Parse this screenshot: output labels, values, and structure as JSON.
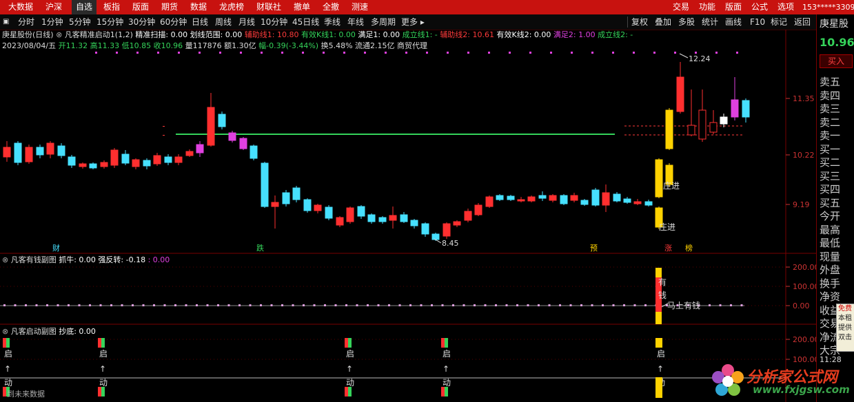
{
  "top_nav": {
    "items": [
      "大数据",
      "沪深",
      "自选",
      "板指",
      "版面",
      "期货",
      "数据",
      "龙虎榜",
      "财联社",
      "撤单",
      "全撤",
      "测速"
    ],
    "active_index": 2,
    "right_items": [
      "交易",
      "功能",
      "版面",
      "公式",
      "选项"
    ],
    "account": "153*****3309",
    "window_controls": [
      "—",
      "□",
      "×"
    ]
  },
  "toolbar": {
    "periods": [
      "分时",
      "1分钟",
      "5分钟",
      "15分钟",
      "30分钟",
      "60分钟",
      "日线",
      "周线",
      "月线",
      "10分钟",
      "45日线",
      "季线",
      "年线",
      "多周期",
      "更多 ▸"
    ],
    "right_items": [
      "复权",
      "叠加",
      "多股",
      "统计",
      "画线",
      "F10",
      "标记",
      "返回"
    ]
  },
  "main_info": {
    "stock": "庚星股份(日线)",
    "indicator": "凡客精准启动1(1,2)",
    "fields": [
      {
        "label": "精准扫描: 0.00",
        "color": "#ffffff"
      },
      {
        "label": "划线范围: 0.00",
        "color": "#ffffff"
      },
      {
        "label": "辅助线1: 10.80",
        "color": "#ff3a3a"
      },
      {
        "label": "有效K线1: 0.00",
        "color": "#35d35a"
      },
      {
        "label": "满足1: 0.00",
        "color": "#ffffff"
      },
      {
        "label": "成立线1: -",
        "color": "#35d35a"
      },
      {
        "label": "辅助线2: 10.61",
        "color": "#ff3a3a"
      },
      {
        "label": "有效K线2: 0.00",
        "color": "#ffffff"
      },
      {
        "label": "满足2: 1.00",
        "color": "#e040e0"
      },
      {
        "label": "成立线2: -",
        "color": "#35d35a"
      }
    ],
    "date": "2023/08/04/五",
    "quote": [
      {
        "label": "开11.32",
        "color": "#35d35a"
      },
      {
        "label": "高11.33",
        "color": "#35d35a"
      },
      {
        "label": "低10.85",
        "color": "#35d35a"
      },
      {
        "label": "收10.96",
        "color": "#35d35a"
      },
      {
        "label": "量117876",
        "color": "#dddddd"
      },
      {
        "label": "额1.30亿",
        "color": "#dddddd"
      },
      {
        "label": "幅-0.39(-3.44%)",
        "color": "#35d35a"
      },
      {
        "label": "换5.48%",
        "color": "#dddddd"
      },
      {
        "label": "流通2.15亿",
        "color": "#dddddd"
      },
      {
        "label": "商贸代理",
        "color": "#dddddd"
      }
    ]
  },
  "main_chart": {
    "price_high_label": "12.24",
    "price_low_label": "8.45",
    "annotations": [
      "庄进",
      "庄进"
    ],
    "event_markers": [
      "财",
      "跌",
      "预",
      "涨",
      "榜"
    ],
    "y_ticks": [
      "11.35",
      "10.22",
      "9.19"
    ]
  },
  "sub1": {
    "title": "凡客有钱副图",
    "fields": [
      {
        "label": "抓牛: 0.00",
        "color": "#ffffff"
      },
      {
        "label": "强反转: -0.18",
        "color": "#ffffff"
      },
      {
        "label": ": 0.00",
        "color": "#e040e0"
      }
    ],
    "annotations": [
      "有",
      "钱",
      "马上有钱"
    ],
    "y_ticks": [
      "200.00",
      "100.00",
      "0.00"
    ]
  },
  "sub2": {
    "title": "凡客启动副图",
    "fields": [
      {
        "label": "抄底: 0.00",
        "color": "#ffffff"
      }
    ],
    "marker_top": "启",
    "marker_bottom": "动",
    "arrow": "↑",
    "footer": "到未来数据",
    "y_ticks": [
      "200.00",
      "100.00"
    ]
  },
  "right_panel": {
    "stock_name": "庚星股",
    "price": "10.96",
    "buy_button": "买入",
    "rows": [
      "卖五",
      "卖四",
      "卖三",
      "卖二",
      "卖一",
      "买一",
      "买二",
      "买三",
      "买四",
      "买五",
      "今开",
      "最高",
      "最低",
      "现量",
      "外盘",
      "换手",
      "净资",
      "收益(-)",
      "交易",
      "净流",
      "大宗"
    ],
    "time": "11:28",
    "popup": [
      "免费",
      "本租",
      "提供",
      "双击"
    ]
  },
  "watermark": {
    "title": "分析家公式网",
    "url": "www.fxjgsw.com"
  },
  "colors": {
    "up": "#ff2f2f",
    "down": "#46e0ff",
    "gold": "#ffd200",
    "magenta": "#e040e0",
    "green": "#35d35a",
    "frame": "#7a0000"
  }
}
